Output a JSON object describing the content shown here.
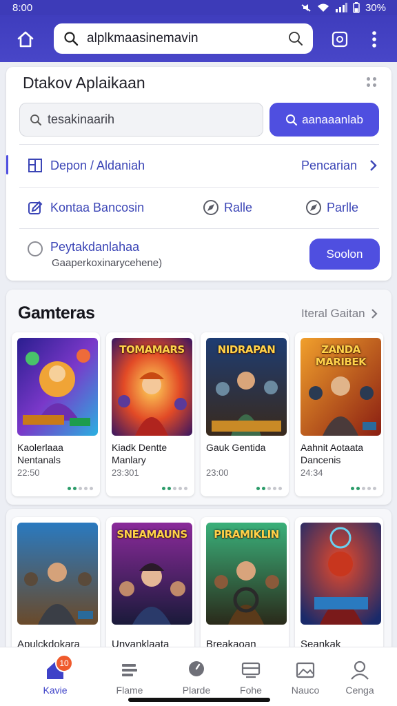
{
  "status_bar": {
    "time": "8:00",
    "battery": "30%"
  },
  "top_bar": {
    "search_query": "alplkmaasinemavin"
  },
  "apps_card": {
    "title": "Dtakov Aplaikaan",
    "search_placeholder": "tesakinaarih",
    "search_button": "aanaaanlab",
    "row1": {
      "left": "Depon / Aldaniah",
      "right": "Pencarian"
    },
    "row2": {
      "left": "Kontaa Bancosin",
      "mid": "Ralle",
      "right": "Parlle"
    },
    "row3": {
      "title": "Peytakdanlahaa",
      "subtitle": "Gaaperkoxinarycehene)",
      "button": "Soolon"
    }
  },
  "games": {
    "title": "Gamteras",
    "see_all": "Iteral Gaitan",
    "items": [
      {
        "cover_title": "",
        "name": "Kaolerlaaa Nentanals",
        "meta": "22:50",
        "dots_on": 2
      },
      {
        "cover_title": "TOMAMARS",
        "name": "Kiadk Dentte Manlary",
        "meta": "23:301",
        "dots_on": 2
      },
      {
        "cover_title": "NIDRAPAN",
        "name": "Gauk Gentida",
        "meta": "23:00",
        "dots_on": 2
      },
      {
        "cover_title": "ZANDA MARIBEK",
        "name": "Aahnit Aotaata Dancenis",
        "meta": "24:34",
        "dots_on": 2
      }
    ]
  },
  "games2": {
    "items": [
      {
        "cover_title": "",
        "name": "Apulckdokara"
      },
      {
        "cover_title": "SNEAMAUNS",
        "name": "Unyanklaata"
      },
      {
        "cover_title": "PIRAMIKLIN",
        "name": "Breakaoan"
      },
      {
        "cover_title": "",
        "name": "Seankak"
      }
    ]
  },
  "bottom_nav": {
    "items": [
      {
        "label": "Kavie",
        "icon": "home-icon",
        "badge": "10"
      },
      {
        "label": "Flame",
        "icon": "list-icon"
      },
      {
        "label": "Plarde",
        "icon": "pin-icon"
      },
      {
        "label": "Fohe",
        "icon": "layers-icon"
      },
      {
        "label": "Nauco",
        "icon": "image-icon"
      },
      {
        "label": "Cenga",
        "icon": "person-icon"
      }
    ]
  },
  "colors": {
    "primary": "#4f4fe0",
    "topbar": "#4240c0",
    "accent_dot": "#2c9c6a",
    "badge": "#ef5a2c"
  }
}
